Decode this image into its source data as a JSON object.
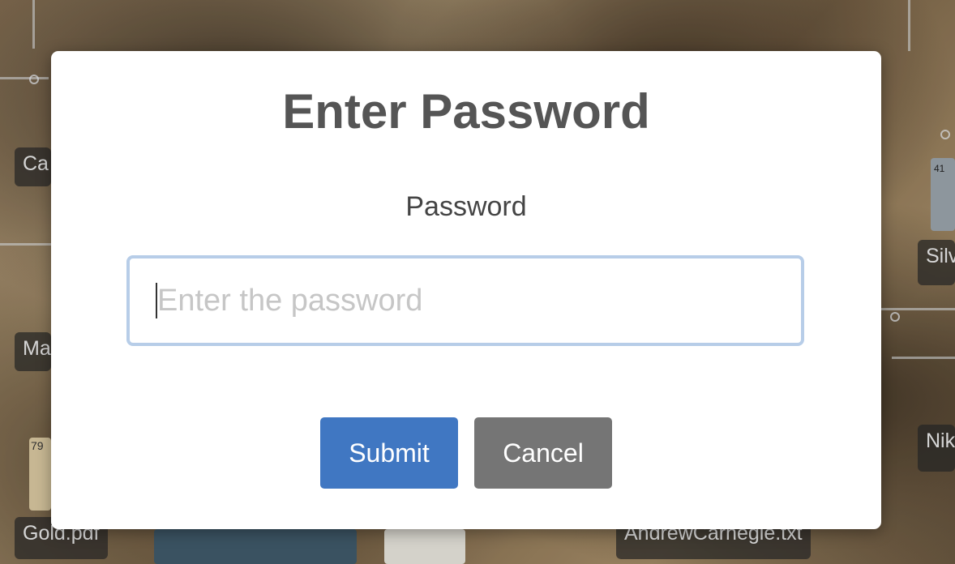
{
  "desktop": {
    "icons": [
      {
        "label": "Ca"
      },
      {
        "label": "Ma"
      },
      {
        "label": "Gold.pdf"
      },
      {
        "label": "AndrewCarnegie.txt"
      },
      {
        "label": "Silv"
      },
      {
        "label": "Nik"
      }
    ],
    "thumbs": [
      {
        "label": "79"
      },
      {
        "label": "41"
      }
    ]
  },
  "dialog": {
    "title": "Enter Password",
    "field_label": "Password",
    "input_value": "",
    "input_placeholder": "Enter the password",
    "submit_label": "Submit",
    "cancel_label": "Cancel"
  },
  "colors": {
    "submit": "#4077c2",
    "cancel": "#757575",
    "input_focus_border": "#b7cde8",
    "title": "#555555"
  }
}
